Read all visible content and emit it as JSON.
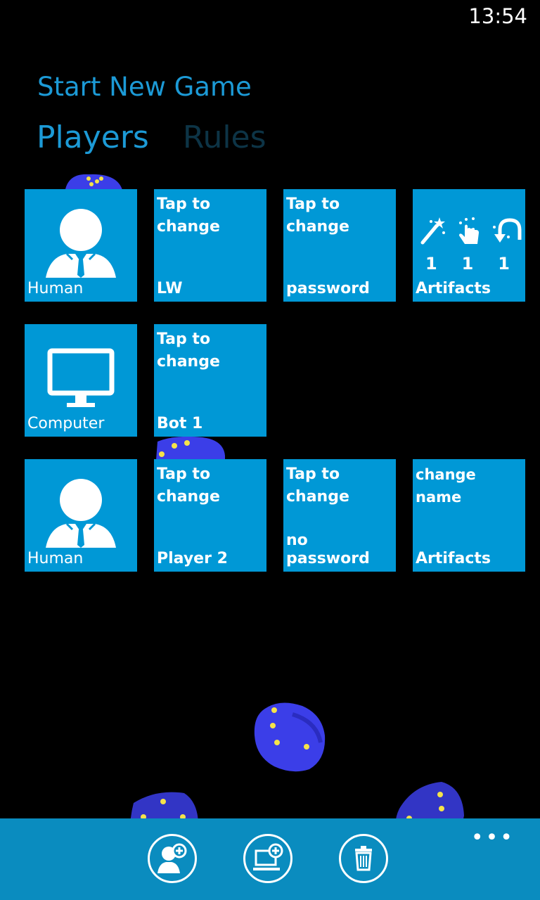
{
  "status_bar": {
    "time": "13:54"
  },
  "page": {
    "title": "Start New Game"
  },
  "pivot": {
    "tabs": [
      "Players",
      "Rules"
    ]
  },
  "players": [
    {
      "type": "Human",
      "name_hint": "Tap to\nchange",
      "name": "LW",
      "password_hint": "Tap to\nchange",
      "password": "password",
      "artifacts_label": "Artifacts",
      "artifacts": [
        {
          "icon": "magic-wand-icon",
          "count": "1"
        },
        {
          "icon": "tap-hand-icon",
          "count": "1"
        },
        {
          "icon": "undo-arrow-icon",
          "count": "1"
        }
      ]
    },
    {
      "type": "Computer",
      "name_hint": "Tap to\nchange",
      "name": "Bot 1"
    },
    {
      "type": "Human",
      "name_hint": "Tap to\nchange",
      "name": "Player 2",
      "password_hint": "Tap to\nchange",
      "password": "no password",
      "artifacts_hint": "change name",
      "artifacts_label": "Artifacts"
    }
  ],
  "app_bar": {
    "buttons": [
      "add-human-player-button",
      "add-computer-player-button",
      "delete-player-button"
    ],
    "more": "•••"
  },
  "colors": {
    "accent": "#1c9ad6",
    "tile": "#0098d6",
    "app_bar": "#0a8cbf",
    "die": "#3b3ee8",
    "pip": "#f5e34a"
  }
}
